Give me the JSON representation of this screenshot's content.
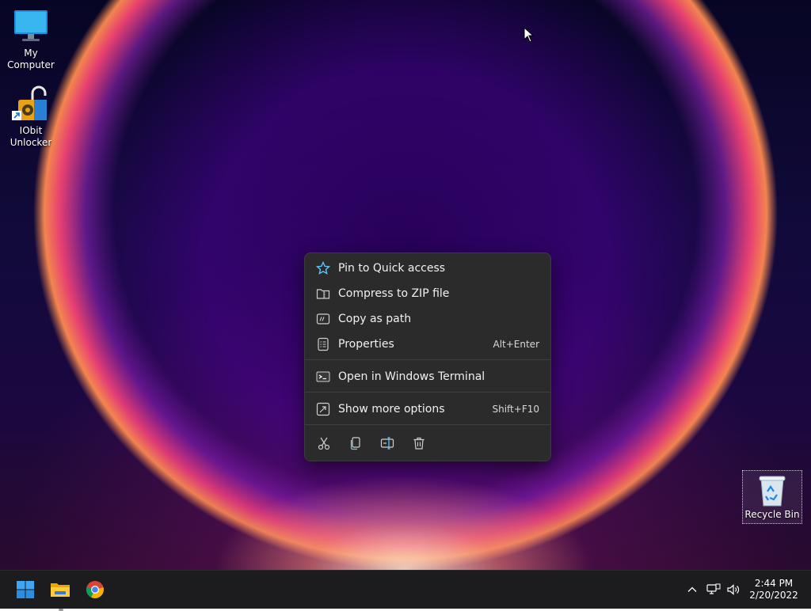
{
  "desktop": {
    "icons": [
      {
        "label": "My Computer",
        "icon": "monitor-icon"
      },
      {
        "label": "IObit Unlocker",
        "icon": "unlock-icon"
      },
      {
        "label": "Recycle Bin",
        "icon": "recycle-bin-icon"
      }
    ]
  },
  "context_menu": {
    "items": [
      {
        "label": "Pin to Quick access",
        "icon": "star-icon",
        "accel": ""
      },
      {
        "label": "Compress to ZIP file",
        "icon": "zip-folder-icon",
        "accel": ""
      },
      {
        "label": "Copy as path",
        "icon": "copy-path-icon",
        "accel": ""
      },
      {
        "label": "Properties",
        "icon": "properties-icon",
        "accel": "Alt+Enter"
      },
      {
        "label": "Open in Windows Terminal",
        "icon": "terminal-icon",
        "accel": ""
      },
      {
        "label": "Show more options",
        "icon": "more-options-icon",
        "accel": "Shift+F10"
      }
    ],
    "actions": [
      "cut-icon",
      "copy-icon",
      "rename-icon",
      "delete-icon"
    ]
  },
  "taskbar": {
    "apps": [
      "windows-start-icon",
      "file-explorer-icon",
      "chrome-icon"
    ],
    "tray": [
      "chevron-up-icon",
      "network-icon",
      "volume-icon"
    ],
    "time": "2:44 PM",
    "date": "2/20/2022"
  },
  "colors": {
    "accent": "#60cdff",
    "menu_bg": "#2b2b2b",
    "taskbar_bg": "#1c1c1f"
  }
}
